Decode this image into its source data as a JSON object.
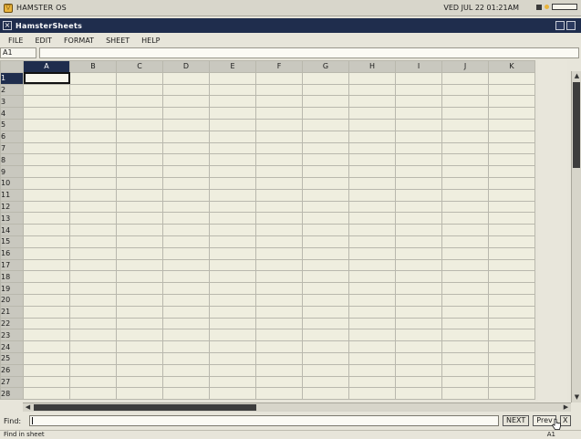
{
  "os": {
    "name": "HAMSTER OS",
    "clock": "VED JUL 22 01:21AM"
  },
  "window": {
    "title": "HamsterSheets"
  },
  "menu": [
    "FILE",
    "EDIT",
    "FORMAT",
    "SHEET",
    "HELP"
  ],
  "cell_ref": "A1",
  "formula": "",
  "columns": [
    "A",
    "B",
    "C",
    "D",
    "E",
    "F",
    "G",
    "H",
    "I",
    "J",
    "K"
  ],
  "rows": [
    "1",
    "2",
    "3",
    "4",
    "5",
    "6",
    "7",
    "8",
    "9",
    "10",
    "11",
    "12",
    "13",
    "14",
    "15",
    "16",
    "17",
    "18",
    "19",
    "20",
    "21",
    "22",
    "23",
    "24",
    "25",
    "26",
    "27",
    "28"
  ],
  "selected_cell": "A1",
  "find": {
    "label": "Find:",
    "value": "",
    "next_label": "NEXT",
    "prev_label": "Prev",
    "close_label": "X"
  },
  "status": {
    "text": "Find in sheet",
    "ref": "A1"
  },
  "colors": {
    "titlebar": "#1f2d4d",
    "accent": "#e9b43c",
    "cell": "#efeedf",
    "header": "#c9c8bf"
  }
}
